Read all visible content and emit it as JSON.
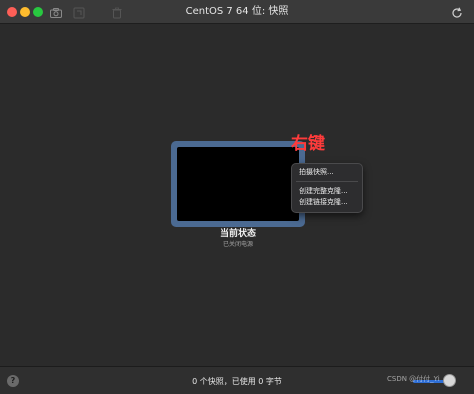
{
  "window": {
    "title": "CentOS 7 64 位: 快照"
  },
  "toolbar": {
    "icons": [
      "camera-icon",
      "revert-icon",
      "trash-icon",
      "reload-icon"
    ]
  },
  "snapshot": {
    "state_title": "当前状态",
    "state_subtitle": "已关闭电源"
  },
  "annotation": {
    "text": "右键",
    "color": "#ff3b3b"
  },
  "context_menu": {
    "items": [
      "拍摄快照...",
      "创建完整克隆...",
      "创建链接克隆..."
    ]
  },
  "bottom": {
    "help_label": "?",
    "status": "0 个快照，已使用 0 字节"
  },
  "watermark": {
    "text": "CSDN @付付_Yi"
  },
  "colors": {
    "accent": "#2f6fd6",
    "snapshot_frame": "#4b6a92"
  }
}
